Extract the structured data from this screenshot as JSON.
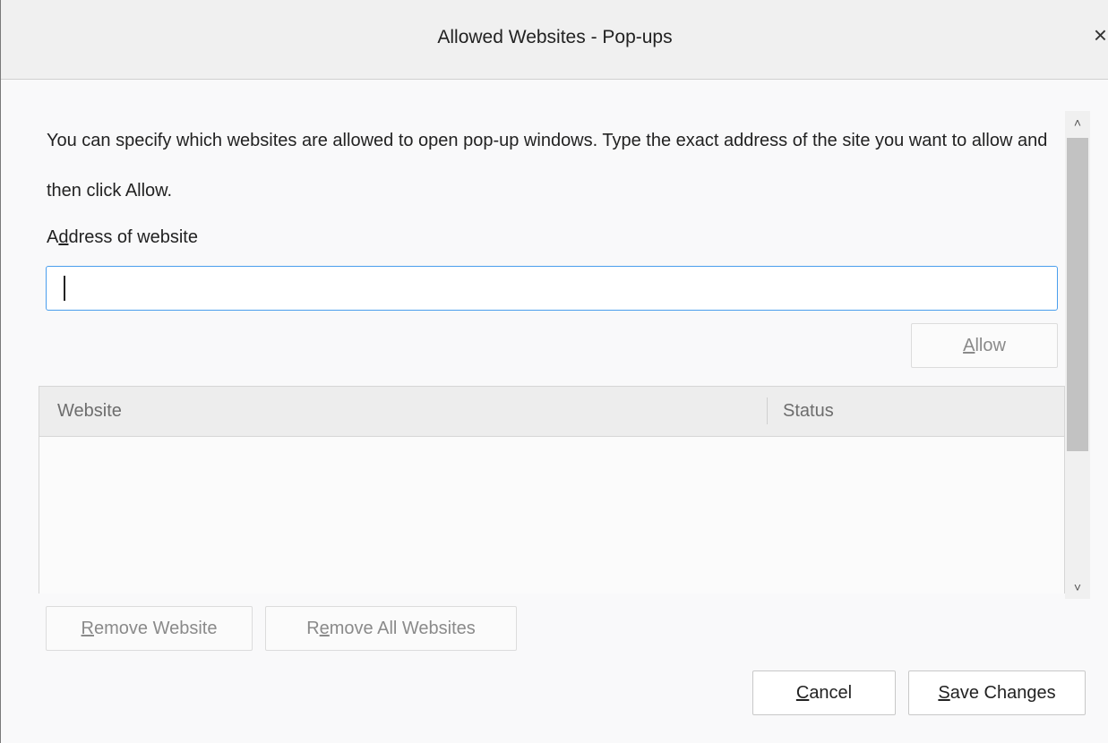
{
  "dialog": {
    "title": "Allowed Websites - Pop-ups",
    "close_glyph": "×"
  },
  "description": "You can specify which websites are allowed to open pop-up windows. Type the exact address of the site you want to allow and then click Allow.",
  "address": {
    "label_prefix": "A",
    "label_access": "d",
    "label_suffix": "dress of website",
    "value": "",
    "placeholder": ""
  },
  "allow_button": {
    "access": "A",
    "rest": "llow"
  },
  "table": {
    "columns": [
      "Website",
      "Status"
    ],
    "rows": []
  },
  "scrollbar": {
    "up_glyph": "˄",
    "down_glyph": "˅"
  },
  "buttons": {
    "remove": {
      "access": "R",
      "rest": "emove Website"
    },
    "remove_all": {
      "prefix": "R",
      "access": "e",
      "rest": "move All Websites"
    },
    "cancel": {
      "access": "C",
      "rest": "ancel"
    },
    "save": {
      "access": "S",
      "rest": "ave Changes"
    }
  },
  "icons": {
    "close": "close-icon",
    "scroll_up": "chevron-up-icon",
    "scroll_down": "chevron-down-icon"
  }
}
